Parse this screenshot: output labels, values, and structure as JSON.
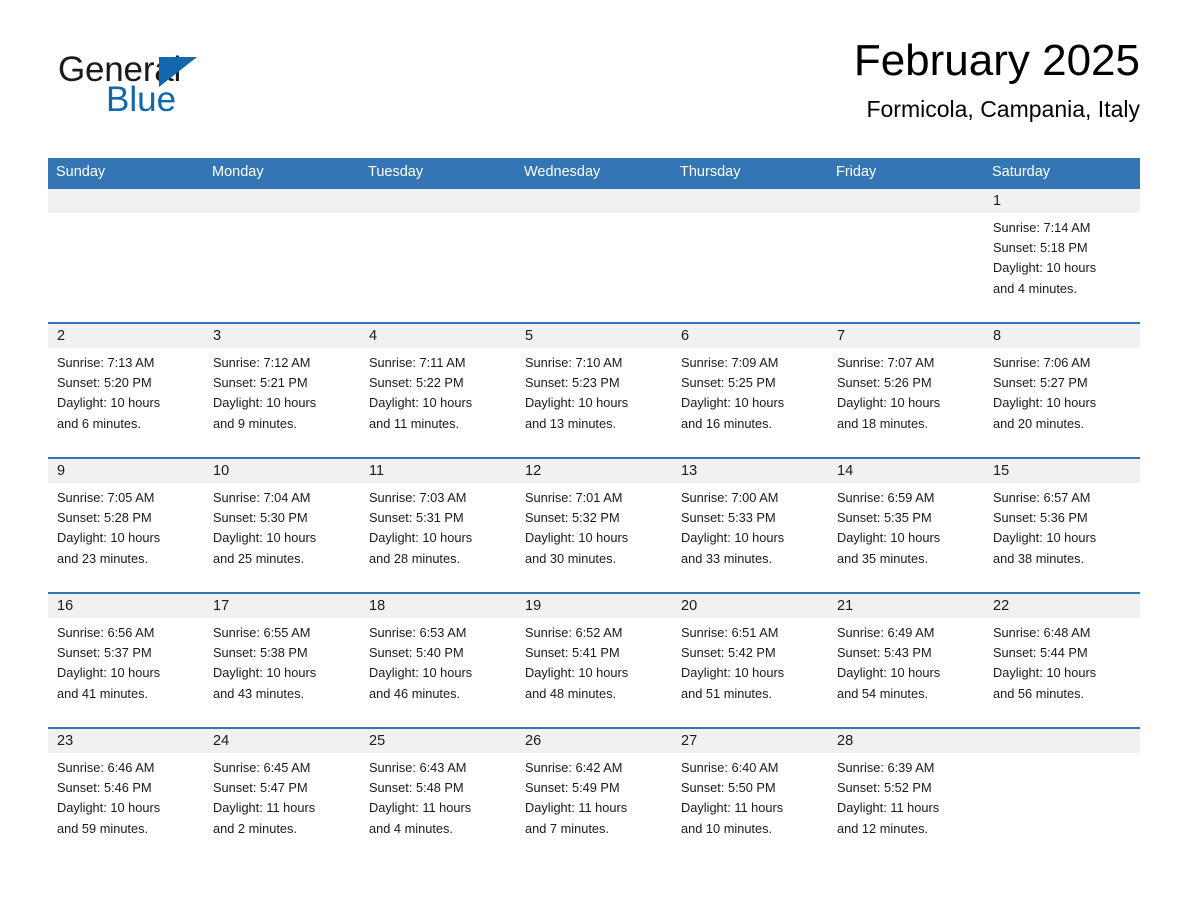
{
  "brand": {
    "name_part1": "General",
    "name_part2": "Blue",
    "accent_color": "#1168ad"
  },
  "header": {
    "title": "February 2025",
    "subtitle": "Formicola, Campania, Italy"
  },
  "theme": {
    "header_blue": "#3375b5",
    "daynum_band": "#f1f1f1",
    "text": "#1a1a1a"
  },
  "weekdays": [
    "Sunday",
    "Monday",
    "Tuesday",
    "Wednesday",
    "Thursday",
    "Friday",
    "Saturday"
  ],
  "labels": {
    "sunrise_prefix": "Sunrise:",
    "sunset_prefix": "Sunset:",
    "daylight_prefix": "Daylight:"
  },
  "weeks": [
    [
      {
        "day": "",
        "sunrise": "",
        "sunset": "",
        "daylight_line1": "",
        "daylight_line2": ""
      },
      {
        "day": "",
        "sunrise": "",
        "sunset": "",
        "daylight_line1": "",
        "daylight_line2": ""
      },
      {
        "day": "",
        "sunrise": "",
        "sunset": "",
        "daylight_line1": "",
        "daylight_line2": ""
      },
      {
        "day": "",
        "sunrise": "",
        "sunset": "",
        "daylight_line1": "",
        "daylight_line2": ""
      },
      {
        "day": "",
        "sunrise": "",
        "sunset": "",
        "daylight_line1": "",
        "daylight_line2": ""
      },
      {
        "day": "",
        "sunrise": "",
        "sunset": "",
        "daylight_line1": "",
        "daylight_line2": ""
      },
      {
        "day": "1",
        "sunrise": "Sunrise: 7:14 AM",
        "sunset": "Sunset: 5:18 PM",
        "daylight_line1": "Daylight: 10 hours",
        "daylight_line2": "and 4 minutes."
      }
    ],
    [
      {
        "day": "2",
        "sunrise": "Sunrise: 7:13 AM",
        "sunset": "Sunset: 5:20 PM",
        "daylight_line1": "Daylight: 10 hours",
        "daylight_line2": "and 6 minutes."
      },
      {
        "day": "3",
        "sunrise": "Sunrise: 7:12 AM",
        "sunset": "Sunset: 5:21 PM",
        "daylight_line1": "Daylight: 10 hours",
        "daylight_line2": "and 9 minutes."
      },
      {
        "day": "4",
        "sunrise": "Sunrise: 7:11 AM",
        "sunset": "Sunset: 5:22 PM",
        "daylight_line1": "Daylight: 10 hours",
        "daylight_line2": "and 11 minutes."
      },
      {
        "day": "5",
        "sunrise": "Sunrise: 7:10 AM",
        "sunset": "Sunset: 5:23 PM",
        "daylight_line1": "Daylight: 10 hours",
        "daylight_line2": "and 13 minutes."
      },
      {
        "day": "6",
        "sunrise": "Sunrise: 7:09 AM",
        "sunset": "Sunset: 5:25 PM",
        "daylight_line1": "Daylight: 10 hours",
        "daylight_line2": "and 16 minutes."
      },
      {
        "day": "7",
        "sunrise": "Sunrise: 7:07 AM",
        "sunset": "Sunset: 5:26 PM",
        "daylight_line1": "Daylight: 10 hours",
        "daylight_line2": "and 18 minutes."
      },
      {
        "day": "8",
        "sunrise": "Sunrise: 7:06 AM",
        "sunset": "Sunset: 5:27 PM",
        "daylight_line1": "Daylight: 10 hours",
        "daylight_line2": "and 20 minutes."
      }
    ],
    [
      {
        "day": "9",
        "sunrise": "Sunrise: 7:05 AM",
        "sunset": "Sunset: 5:28 PM",
        "daylight_line1": "Daylight: 10 hours",
        "daylight_line2": "and 23 minutes."
      },
      {
        "day": "10",
        "sunrise": "Sunrise: 7:04 AM",
        "sunset": "Sunset: 5:30 PM",
        "daylight_line1": "Daylight: 10 hours",
        "daylight_line2": "and 25 minutes."
      },
      {
        "day": "11",
        "sunrise": "Sunrise: 7:03 AM",
        "sunset": "Sunset: 5:31 PM",
        "daylight_line1": "Daylight: 10 hours",
        "daylight_line2": "and 28 minutes."
      },
      {
        "day": "12",
        "sunrise": "Sunrise: 7:01 AM",
        "sunset": "Sunset: 5:32 PM",
        "daylight_line1": "Daylight: 10 hours",
        "daylight_line2": "and 30 minutes."
      },
      {
        "day": "13",
        "sunrise": "Sunrise: 7:00 AM",
        "sunset": "Sunset: 5:33 PM",
        "daylight_line1": "Daylight: 10 hours",
        "daylight_line2": "and 33 minutes."
      },
      {
        "day": "14",
        "sunrise": "Sunrise: 6:59 AM",
        "sunset": "Sunset: 5:35 PM",
        "daylight_line1": "Daylight: 10 hours",
        "daylight_line2": "and 35 minutes."
      },
      {
        "day": "15",
        "sunrise": "Sunrise: 6:57 AM",
        "sunset": "Sunset: 5:36 PM",
        "daylight_line1": "Daylight: 10 hours",
        "daylight_line2": "and 38 minutes."
      }
    ],
    [
      {
        "day": "16",
        "sunrise": "Sunrise: 6:56 AM",
        "sunset": "Sunset: 5:37 PM",
        "daylight_line1": "Daylight: 10 hours",
        "daylight_line2": "and 41 minutes."
      },
      {
        "day": "17",
        "sunrise": "Sunrise: 6:55 AM",
        "sunset": "Sunset: 5:38 PM",
        "daylight_line1": "Daylight: 10 hours",
        "daylight_line2": "and 43 minutes."
      },
      {
        "day": "18",
        "sunrise": "Sunrise: 6:53 AM",
        "sunset": "Sunset: 5:40 PM",
        "daylight_line1": "Daylight: 10 hours",
        "daylight_line2": "and 46 minutes."
      },
      {
        "day": "19",
        "sunrise": "Sunrise: 6:52 AM",
        "sunset": "Sunset: 5:41 PM",
        "daylight_line1": "Daylight: 10 hours",
        "daylight_line2": "and 48 minutes."
      },
      {
        "day": "20",
        "sunrise": "Sunrise: 6:51 AM",
        "sunset": "Sunset: 5:42 PM",
        "daylight_line1": "Daylight: 10 hours",
        "daylight_line2": "and 51 minutes."
      },
      {
        "day": "21",
        "sunrise": "Sunrise: 6:49 AM",
        "sunset": "Sunset: 5:43 PM",
        "daylight_line1": "Daylight: 10 hours",
        "daylight_line2": "and 54 minutes."
      },
      {
        "day": "22",
        "sunrise": "Sunrise: 6:48 AM",
        "sunset": "Sunset: 5:44 PM",
        "daylight_line1": "Daylight: 10 hours",
        "daylight_line2": "and 56 minutes."
      }
    ],
    [
      {
        "day": "23",
        "sunrise": "Sunrise: 6:46 AM",
        "sunset": "Sunset: 5:46 PM",
        "daylight_line1": "Daylight: 10 hours",
        "daylight_line2": "and 59 minutes."
      },
      {
        "day": "24",
        "sunrise": "Sunrise: 6:45 AM",
        "sunset": "Sunset: 5:47 PM",
        "daylight_line1": "Daylight: 11 hours",
        "daylight_line2": "and 2 minutes."
      },
      {
        "day": "25",
        "sunrise": "Sunrise: 6:43 AM",
        "sunset": "Sunset: 5:48 PM",
        "daylight_line1": "Daylight: 11 hours",
        "daylight_line2": "and 4 minutes."
      },
      {
        "day": "26",
        "sunrise": "Sunrise: 6:42 AM",
        "sunset": "Sunset: 5:49 PM",
        "daylight_line1": "Daylight: 11 hours",
        "daylight_line2": "and 7 minutes."
      },
      {
        "day": "27",
        "sunrise": "Sunrise: 6:40 AM",
        "sunset": "Sunset: 5:50 PM",
        "daylight_line1": "Daylight: 11 hours",
        "daylight_line2": "and 10 minutes."
      },
      {
        "day": "28",
        "sunrise": "Sunrise: 6:39 AM",
        "sunset": "Sunset: 5:52 PM",
        "daylight_line1": "Daylight: 11 hours",
        "daylight_line2": "and 12 minutes."
      },
      {
        "day": "",
        "sunrise": "",
        "sunset": "",
        "daylight_line1": "",
        "daylight_line2": ""
      }
    ]
  ]
}
